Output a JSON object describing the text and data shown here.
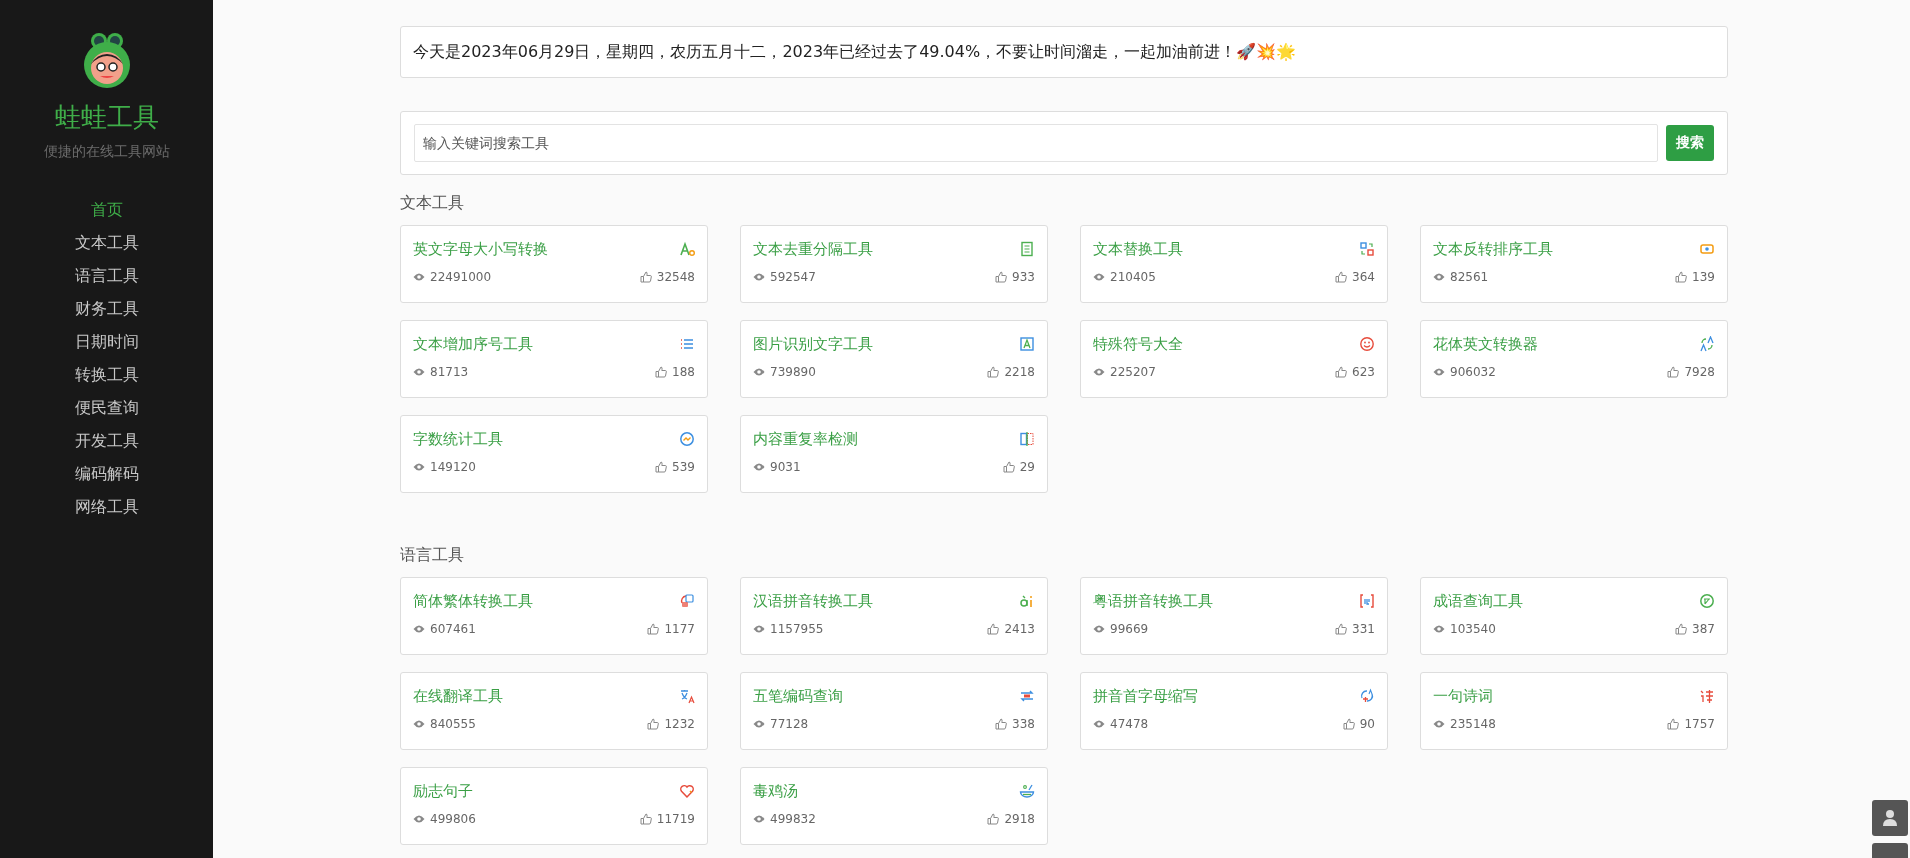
{
  "sidebar": {
    "title": "蛙蛙工具",
    "subtitle": "便捷的在线工具网站",
    "items": [
      {
        "label": "首页",
        "selected": true
      },
      {
        "label": "文本工具",
        "selected": false
      },
      {
        "label": "语言工具",
        "selected": false
      },
      {
        "label": "财务工具",
        "selected": false
      },
      {
        "label": "日期时间",
        "selected": false
      },
      {
        "label": "转换工具",
        "selected": false
      },
      {
        "label": "便民查询",
        "selected": false
      },
      {
        "label": "开发工具",
        "selected": false
      },
      {
        "label": "编码解码",
        "selected": false
      },
      {
        "label": "网络工具",
        "selected": false
      }
    ]
  },
  "banner": "今天是2023年06月29日，星期四，农历五月十二，2023年已经过去了49.04%，不要让时间溜走，一起加油前进！🚀💥🌟",
  "search": {
    "placeholder": "输入关键词搜索工具",
    "button": "搜索"
  },
  "sections": [
    {
      "title": "文本工具",
      "tools": [
        {
          "name": "英文字母大小写转换",
          "views": "22491000",
          "likes": "32548"
        },
        {
          "name": "文本去重分隔工具",
          "views": "592547",
          "likes": "933"
        },
        {
          "name": "文本替换工具",
          "views": "210405",
          "likes": "364"
        },
        {
          "name": "文本反转排序工具",
          "views": "82561",
          "likes": "139"
        },
        {
          "name": "文本增加序号工具",
          "views": "81713",
          "likes": "188"
        },
        {
          "name": "图片识别文字工具",
          "views": "739890",
          "likes": "2218"
        },
        {
          "name": "特殊符号大全",
          "views": "225207",
          "likes": "623"
        },
        {
          "name": "花体英文转换器",
          "views": "906032",
          "likes": "7928"
        },
        {
          "name": "字数统计工具",
          "views": "149120",
          "likes": "539"
        },
        {
          "name": "内容重复率检测",
          "views": "9031",
          "likes": "29"
        }
      ]
    },
    {
      "title": "语言工具",
      "tools": [
        {
          "name": "简体繁体转换工具",
          "views": "607461",
          "likes": "1177"
        },
        {
          "name": "汉语拼音转换工具",
          "views": "1157955",
          "likes": "2413"
        },
        {
          "name": "粤语拼音转换工具",
          "views": "99669",
          "likes": "331"
        },
        {
          "name": "成语查询工具",
          "views": "103540",
          "likes": "387"
        },
        {
          "name": "在线翻译工具",
          "views": "840555",
          "likes": "1232"
        },
        {
          "name": "五笔编码查询",
          "views": "77128",
          "likes": "338"
        },
        {
          "name": "拼音首字母缩写",
          "views": "47478",
          "likes": "90"
        },
        {
          "name": "一句诗词",
          "views": "235148",
          "likes": "1757"
        },
        {
          "name": "励志句子",
          "views": "499806",
          "likes": "11719"
        },
        {
          "name": "毒鸡汤",
          "views": "499832",
          "likes": "2918"
        }
      ]
    }
  ]
}
